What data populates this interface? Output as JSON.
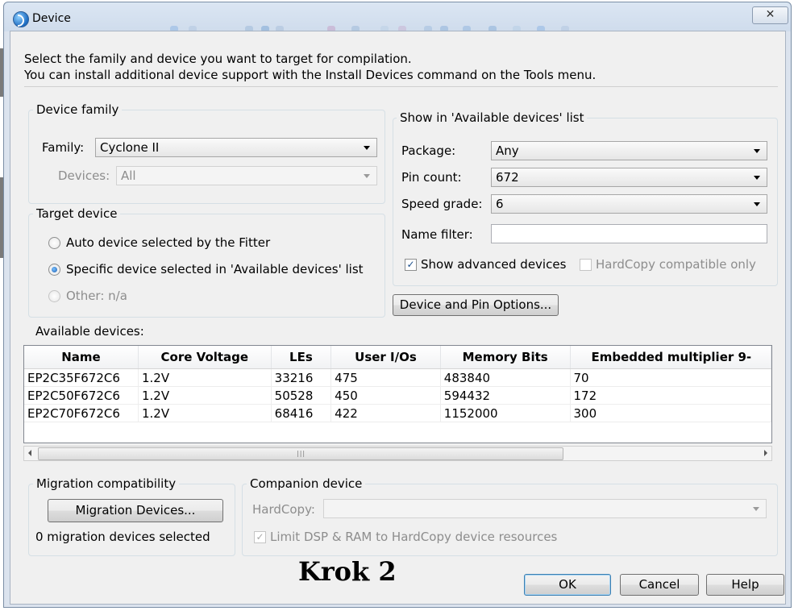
{
  "window": {
    "title": "Device",
    "close_glyph": "✕"
  },
  "intro": {
    "line1": "Select the family and device you want to target for compilation.",
    "line2": "You can install additional device support with the Install Devices command on the Tools menu."
  },
  "device_family": {
    "group_title": "Device family",
    "family_label": "Family:",
    "family_value": "Cyclone II",
    "devices_label": "Devices:",
    "devices_value": "All"
  },
  "target_device": {
    "group_title": "Target device",
    "options": [
      {
        "label": "Auto device selected by the Fitter",
        "checked": false,
        "enabled": true
      },
      {
        "label": "Specific device selected in 'Available devices' list",
        "checked": true,
        "enabled": true
      },
      {
        "label": "Other:  n/a",
        "checked": false,
        "enabled": false
      }
    ]
  },
  "show_in_list": {
    "group_title": "Show in 'Available devices' list",
    "package_label": "Package:",
    "package_value": "Any",
    "pin_count_label": "Pin count:",
    "pin_count_value": "672",
    "speed_grade_label": "Speed grade:",
    "speed_grade_value": "6",
    "name_filter_label": "Name filter:",
    "name_filter_value": "",
    "show_advanced_label": "Show advanced devices",
    "show_advanced_checked": true,
    "hardcopy_label": "HardCopy compatible only",
    "hardcopy_checked": false
  },
  "device_pin_options_label": "Device and Pin Options...",
  "available_devices": {
    "label": "Available devices:",
    "columns": [
      "Name",
      "Core Voltage",
      "LEs",
      "User I/Os",
      "Memory Bits",
      "Embedded multiplier 9-"
    ],
    "rows": [
      [
        "EP2C35F672C6",
        "1.2V",
        "33216",
        "475",
        "483840",
        "70"
      ],
      [
        "EP2C50F672C6",
        "1.2V",
        "50528",
        "450",
        "594432",
        "172"
      ],
      [
        "EP2C70F672C6",
        "1.2V",
        "68416",
        "422",
        "1152000",
        "300"
      ]
    ]
  },
  "migration": {
    "group_title": "Migration compatibility",
    "button_label": "Migration Devices...",
    "status": "0 migration devices selected"
  },
  "companion": {
    "group_title": "Companion device",
    "hardcopy_label": "HardCopy:",
    "hardcopy_value": "",
    "limit_label": "Limit DSP & RAM to HardCopy device resources",
    "limit_checked": true
  },
  "caption": "Krok 2",
  "buttons": {
    "ok": "OK",
    "cancel": "Cancel",
    "help": "Help"
  }
}
